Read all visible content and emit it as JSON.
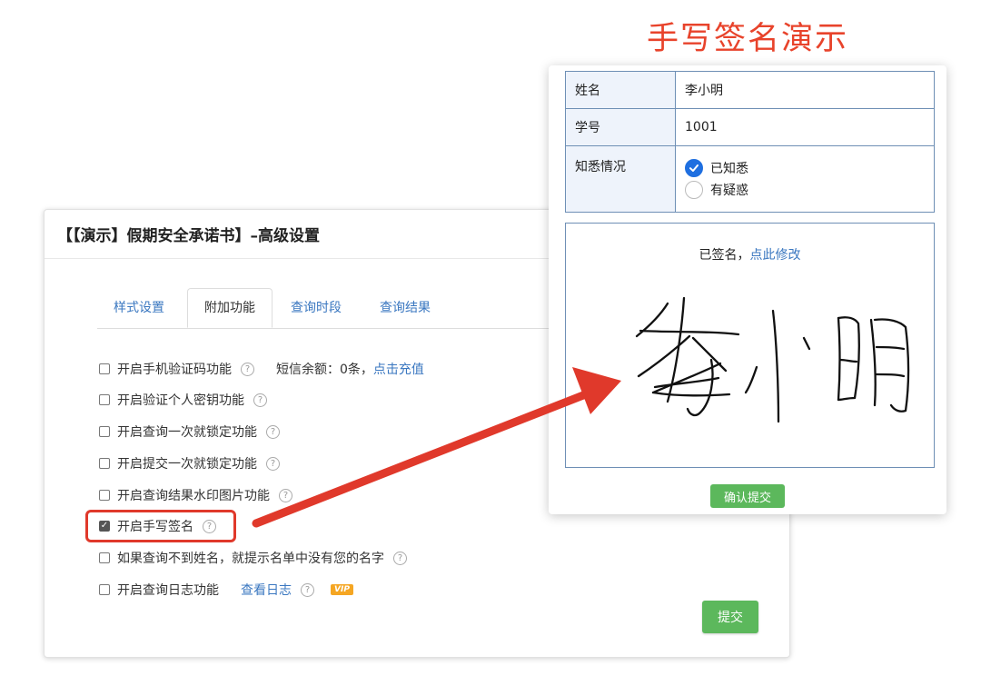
{
  "hero_title": "手写签名演示",
  "panel": {
    "title": "【【演示】假期安全承诺书】–高级设置",
    "tabs": [
      {
        "label": "样式设置",
        "active": false
      },
      {
        "label": "附加功能",
        "active": true
      },
      {
        "label": "查询时段",
        "active": false
      },
      {
        "label": "查询结果",
        "active": false
      }
    ],
    "options": [
      {
        "label": "开启手机验证码功能",
        "checked": false,
        "extra_text": "短信余额：0条，",
        "extra_link": "点击充值"
      },
      {
        "label": "开启验证个人密钥功能",
        "checked": false
      },
      {
        "label": "开启查询一次就锁定功能",
        "checked": false
      },
      {
        "label": "开启提交一次就锁定功能",
        "checked": false
      },
      {
        "label": "开启查询结果水印图片功能",
        "checked": false
      },
      {
        "label": "开启手写签名",
        "checked": true
      },
      {
        "label": "如果查询不到姓名，就提示名单中没有您的名字",
        "checked": false
      },
      {
        "label": "开启查询日志功能",
        "checked": false,
        "link": "查看日志",
        "badge": "VIP"
      }
    ],
    "help_glyph": "?",
    "submit_label": "提交"
  },
  "card": {
    "rows": [
      {
        "label": "姓名",
        "value": "李小明"
      },
      {
        "label": "学号",
        "value": "1001"
      }
    ],
    "status_label": "知悉情况",
    "radio_options": [
      {
        "label": "已知悉",
        "checked": true
      },
      {
        "label": "有疑惑",
        "checked": false
      }
    ],
    "signature_status": "已签名，",
    "signature_link": "点此修改",
    "confirm_label": "确认提交"
  },
  "colors": {
    "accent_red": "#e8432b",
    "link_blue": "#3a77c0",
    "button_green": "#5cb85c",
    "radio_blue": "#1f6fe0"
  }
}
